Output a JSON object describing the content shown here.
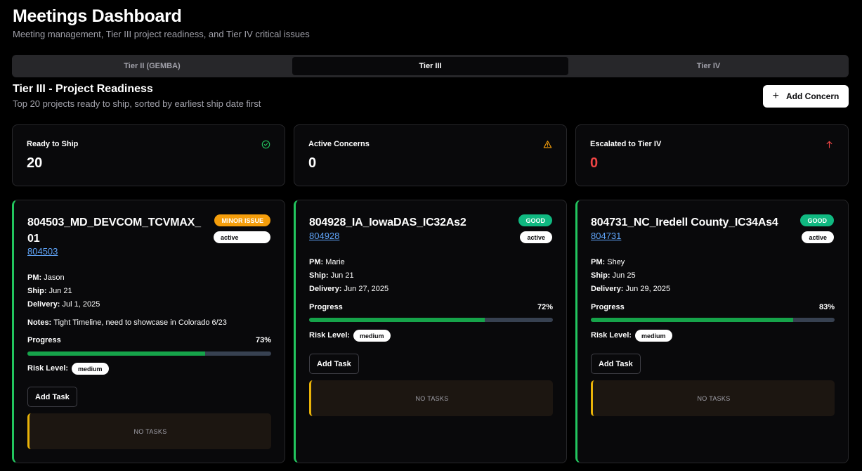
{
  "header": {
    "title": "Meetings Dashboard",
    "subtitle": "Meeting management, Tier III project readiness, and Tier IV critical issues"
  },
  "tabs": [
    {
      "label": "Tier II (GEMBA)",
      "active": false
    },
    {
      "label": "Tier III",
      "active": true
    },
    {
      "label": "Tier IV",
      "active": false
    }
  ],
  "section": {
    "title": "Tier III - Project Readiness",
    "subtitle": "Top 20 projects ready to ship, sorted by earliest ship date first",
    "add_concern_label": "Add Concern"
  },
  "stats": [
    {
      "label": "Ready to Ship",
      "value": "20",
      "icon": "check-circle-icon",
      "color": "#22c55e"
    },
    {
      "label": "Active Concerns",
      "value": "0",
      "icon": "warning-icon",
      "color": "#f59e0b"
    },
    {
      "label": "Escalated to Tier IV",
      "value": "0",
      "icon": "arrow-up-icon",
      "color": "#ef4444"
    }
  ],
  "labels": {
    "pm": "PM:",
    "ship": "Ship:",
    "delivery": "Delivery:",
    "notes": "Notes:",
    "progress": "Progress",
    "risk": "Risk Level:",
    "add_task": "Add Task",
    "no_tasks": "NO TASKS"
  },
  "projects": [
    {
      "title": "804503_MD_DEVCOM_TCVMAX_01",
      "link": "804503",
      "status_badge": "MINOR ISSUE",
      "state": "active",
      "pm": "Jason",
      "ship": "Jun 21",
      "delivery": "Jul 1, 2025",
      "notes": "Tight Timeline, need to showcase in Colorado 6/23",
      "progress": "73%",
      "progress_value": 0.73,
      "risk": "medium"
    },
    {
      "title": "804928_IA_IowaDAS_IC32As2",
      "link": "804928",
      "status_badge": "GOOD",
      "state": "active",
      "pm": "Marie",
      "ship": "Jun 21",
      "delivery": "Jun 27, 2025",
      "progress": "72%",
      "progress_value": 0.72,
      "risk": "medium"
    },
    {
      "title": "804731_NC_Iredell County_IC34As4",
      "link": "804731",
      "status_badge": "GOOD",
      "state": "active",
      "pm": "Shey",
      "ship": "Jun 25",
      "delivery": "Jun 29, 2025",
      "progress": "83%",
      "progress_value": 0.83,
      "risk": "medium"
    }
  ]
}
